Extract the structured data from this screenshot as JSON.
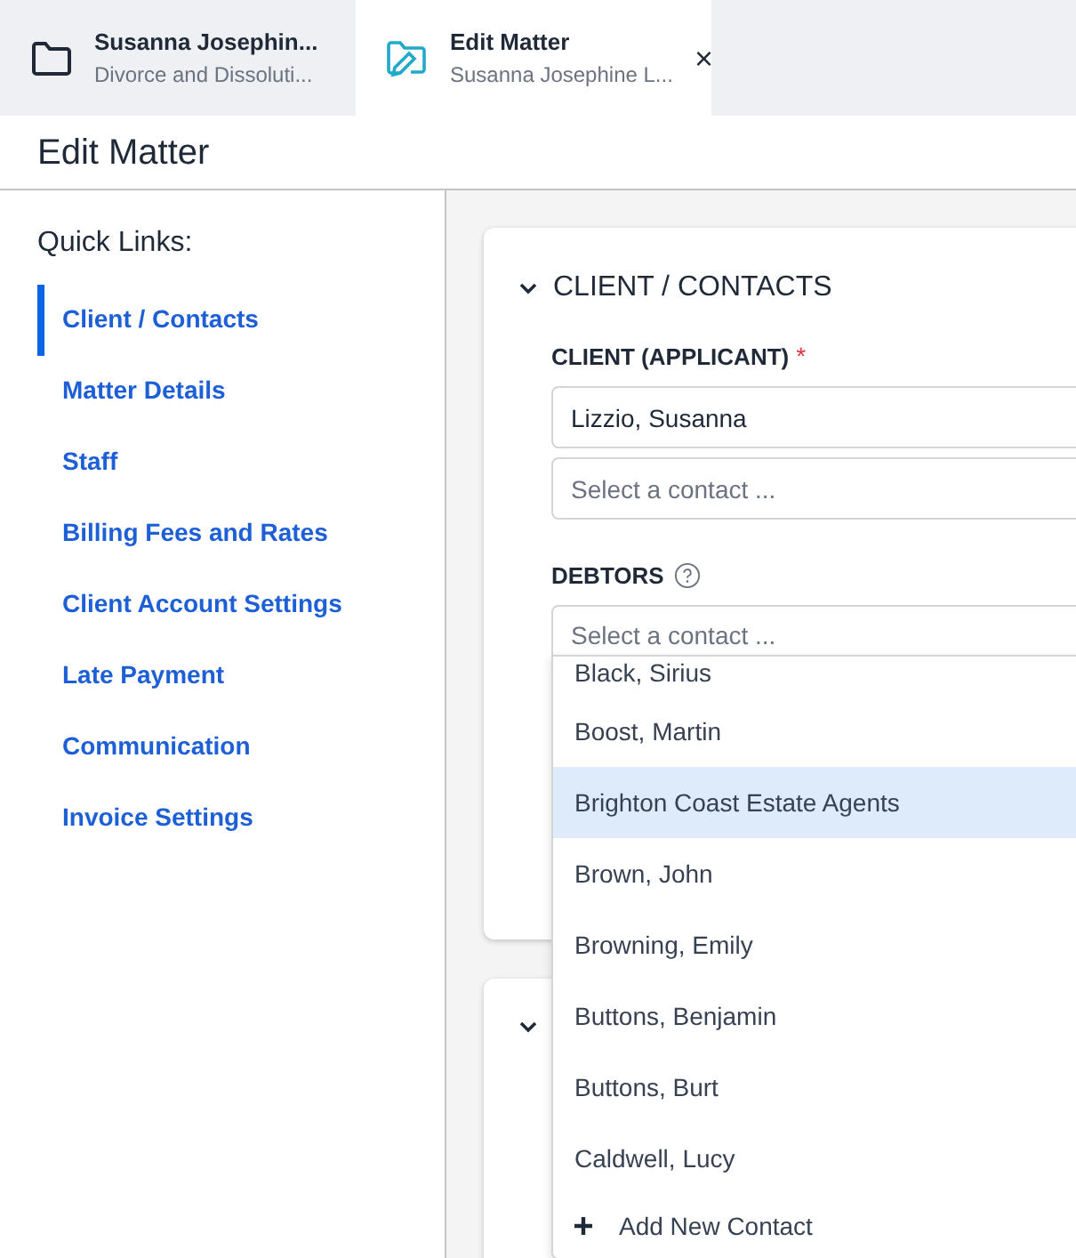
{
  "tabs": [
    {
      "title": "Susanna Josephin...",
      "subtitle": "Divorce and Dissoluti...",
      "kind": "folder",
      "selected": false
    },
    {
      "title": "Edit Matter",
      "subtitle": "Susanna Josephine L...",
      "kind": "edit",
      "selected": true,
      "close": "×"
    }
  ],
  "page_title": "Edit Matter",
  "sidebar": {
    "heading": "Quick Links:",
    "items": [
      {
        "label": "Client / Contacts",
        "selected": true
      },
      {
        "label": "Matter Details",
        "selected": false
      },
      {
        "label": "Staff",
        "selected": false
      },
      {
        "label": "Billing Fees and Rates",
        "selected": false
      },
      {
        "label": "Client Account Settings",
        "selected": false
      },
      {
        "label": "Late Payment",
        "selected": false
      },
      {
        "label": "Communication",
        "selected": false
      },
      {
        "label": "Invoice Settings",
        "selected": false
      }
    ]
  },
  "section": {
    "title": "CLIENT / CONTACTS",
    "expanded": true,
    "client_label": "CLIENT (APPLICANT)",
    "required_mark": "*",
    "client_value": "Lizzio, Susanna",
    "client_placeholder": "Select a contact ...",
    "debtors_label": "DEBTORS",
    "debtors_placeholder": "Select a contact ..."
  },
  "second_section": {
    "expanded": true
  },
  "dropdown": {
    "options": [
      {
        "label": "Black, Sirius",
        "selected": false
      },
      {
        "label": "Boost, Martin",
        "selected": false
      },
      {
        "label": "Brighton Coast Estate Agents",
        "selected": true
      },
      {
        "label": "Brown, John",
        "selected": false
      },
      {
        "label": "Browning, Emily",
        "selected": false
      },
      {
        "label": "Buttons, Benjamin",
        "selected": false
      },
      {
        "label": "Buttons, Burt",
        "selected": false
      },
      {
        "label": "Caldwell, Lucy",
        "selected": false
      }
    ],
    "add_label": "Add New Contact"
  }
}
